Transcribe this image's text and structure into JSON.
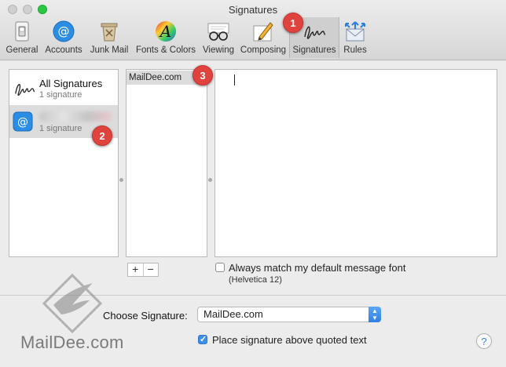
{
  "window": {
    "title": "Signatures"
  },
  "toolbar": {
    "items": [
      {
        "label": "General",
        "icon": "general-switch-icon"
      },
      {
        "label": "Accounts",
        "icon": "at-sign-icon"
      },
      {
        "label": "Junk Mail",
        "icon": "trash-bin-icon"
      },
      {
        "label": "Fonts & Colors",
        "icon": "font-a-icon"
      },
      {
        "label": "Viewing",
        "icon": "glasses-icon"
      },
      {
        "label": "Composing",
        "icon": "pencil-icon"
      },
      {
        "label": "Signatures",
        "icon": "signature-icon",
        "selected": true
      },
      {
        "label": "Rules",
        "icon": "rules-icon"
      }
    ]
  },
  "badges": [
    "1",
    "2",
    "3"
  ],
  "accounts": [
    {
      "name": "All Signatures",
      "count": "1 signature",
      "icon": "signature-icon"
    },
    {
      "name": "",
      "count": "1 signature",
      "icon": "at-sign-icon",
      "selected": true
    }
  ],
  "signatures": [
    {
      "name": "MailDee.com",
      "selected": true
    }
  ],
  "buttons": {
    "add": "+",
    "remove": "−"
  },
  "options": {
    "match_font_label": "Always match my default message font",
    "match_font_checked": false,
    "font_note": "(Helvetica 12)",
    "above_quoted_label": "Place signature above quoted text",
    "above_quoted_checked": true
  },
  "choose": {
    "label": "Choose Signature:",
    "value": "MailDee.com"
  },
  "help": "?",
  "watermark": {
    "text": "MailDee.com"
  },
  "colors": {
    "badge": "#e0433e",
    "accent": "#3b8ee9"
  }
}
